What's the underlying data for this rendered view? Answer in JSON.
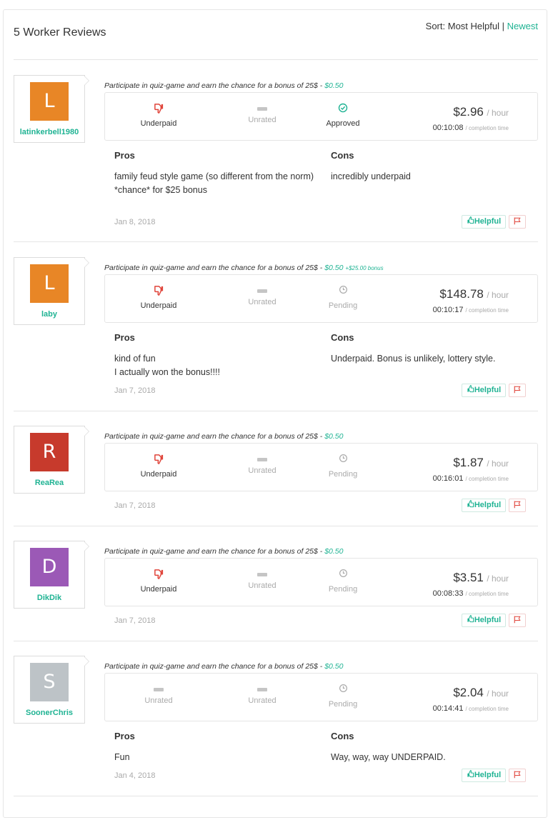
{
  "header": {
    "title": "5 Worker Reviews",
    "sort_prefix": "Sort:",
    "sort_most_helpful": "Most Helpful",
    "sort_separator": "|",
    "sort_newest": "Newest"
  },
  "colors": {
    "accent": "#1fb393",
    "underpaid_red": "#e0443a",
    "avatar_orange": "#e88626",
    "avatar_red": "#c73a2c",
    "avatar_purple": "#9b59b6",
    "avatar_gray": "#bdc3c7"
  },
  "labels": {
    "per_hour": "/ hour",
    "completion_time": "/ completion time",
    "pros": "Pros",
    "cons": "Cons",
    "helpful": "Helpful"
  },
  "reviews": [
    {
      "initial": "L",
      "username": "latinkerbell1980",
      "avatar_color": "#e88626",
      "hit_title": "Participate in quiz-game and earn the chance for a bonus of 25$ -",
      "reward": "$0.50",
      "bonus": "",
      "pay_rating": "Underpaid",
      "comm_rating": "Unrated",
      "approval": "Approved",
      "hourly": "$2.96",
      "completion": "00:10:08",
      "pros": "family feud style game (so different from the norm)\n*chance* for $25 bonus",
      "cons": "incredibly underpaid",
      "date": "Jan 8, 2018"
    },
    {
      "initial": "L",
      "username": "laby",
      "avatar_color": "#e88626",
      "hit_title": "Participate in quiz-game and earn the chance for a bonus of 25$ -",
      "reward": "$0.50",
      "bonus": "+$25.00 bonus",
      "pay_rating": "Underpaid",
      "comm_rating": "Unrated",
      "approval": "Pending",
      "hourly": "$148.78",
      "completion": "00:10:17",
      "pros": "kind of fun\nI actually won the bonus!!!!",
      "cons": "Underpaid. Bonus is unlikely, lottery style.",
      "date": "Jan 7, 2018"
    },
    {
      "initial": "R",
      "username": "ReaRea",
      "avatar_color": "#c73a2c",
      "hit_title": "Participate in quiz-game and earn the chance for a bonus of 25$ -",
      "reward": "$0.50",
      "bonus": "",
      "pay_rating": "Underpaid",
      "comm_rating": "Unrated",
      "approval": "Pending",
      "hourly": "$1.87",
      "completion": "00:16:01",
      "pros": "",
      "cons": "",
      "date": "Jan 7, 2018"
    },
    {
      "initial": "D",
      "username": "DikDik",
      "avatar_color": "#9b59b6",
      "hit_title": "Participate in quiz-game and earn the chance for a bonus of 25$ -",
      "reward": "$0.50",
      "bonus": "",
      "pay_rating": "Underpaid",
      "comm_rating": "Unrated",
      "approval": "Pending",
      "hourly": "$3.51",
      "completion": "00:08:33",
      "pros": "",
      "cons": "",
      "date": "Jan 7, 2018"
    },
    {
      "initial": "S",
      "username": "SoonerChris",
      "avatar_color": "#bdc3c7",
      "hit_title": "Participate in quiz-game and earn the chance for a bonus of 25$ -",
      "reward": "$0.50",
      "bonus": "",
      "pay_rating": "Unrated",
      "comm_rating": "Unrated",
      "approval": "Pending",
      "hourly": "$2.04",
      "completion": "00:14:41",
      "pros": "Fun",
      "cons": "Way, way, way UNDERPAID.",
      "date": "Jan 4, 2018"
    }
  ]
}
